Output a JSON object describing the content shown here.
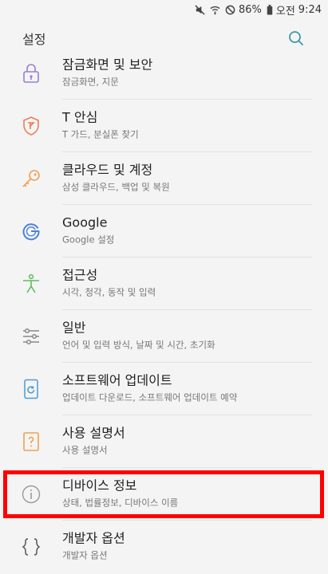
{
  "status_bar": {
    "battery_pct": "86%",
    "ampm": "오전",
    "time": "9:24",
    "icons": [
      "mute-icon",
      "wifi-icon",
      "no-disturb-icon",
      "battery-icon"
    ]
  },
  "app_bar": {
    "title": "설정",
    "search_icon": "search-icon"
  },
  "items": [
    {
      "title": "잠금화면 및 보안",
      "sub": "잠금화면, 지문",
      "icon": "lock-icon",
      "color": "#9b7fd4"
    },
    {
      "title": "T 안심",
      "sub": "T 가드, 분실폰 찾기",
      "icon": "shield-icon",
      "color": "#f07b56"
    },
    {
      "title": "클라우드 및 계정",
      "sub": "삼성 클라우드, 백업 및 복원",
      "icon": "key-icon",
      "color": "#f0a050"
    },
    {
      "title": "Google",
      "sub": "Google 설정",
      "icon": "google-icon",
      "color": "#4a82d8"
    },
    {
      "title": "접근성",
      "sub": "시각, 청각, 동작 및 입력",
      "icon": "accessibility-icon",
      "color": "#5bbf5b"
    },
    {
      "title": "일반",
      "sub": "언어 및 입력 방식, 날짜 및 시간, 초기화",
      "icon": "sliders-icon",
      "color": "#888888"
    },
    {
      "title": "소프트웨어 업데이트",
      "sub": "업데이트 다운로드, 소프트웨어 업데이트 예약",
      "icon": "update-icon",
      "color": "#4a9ad8"
    },
    {
      "title": "사용 설명서",
      "sub": "사용 설명서",
      "icon": "manual-icon",
      "color": "#f0a050"
    },
    {
      "title": "디바이스 정보",
      "sub": "상태, 법률정보, 디바이스 이름",
      "icon": "info-icon",
      "color": "#999999"
    },
    {
      "title": "개발자 옵션",
      "sub": "개발자 옵션",
      "icon": "braces-icon",
      "color": "#555555"
    }
  ],
  "highlight_color": "#ff0000"
}
